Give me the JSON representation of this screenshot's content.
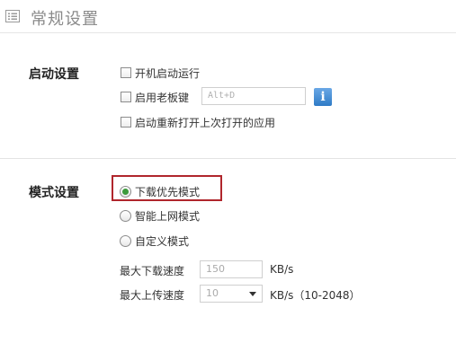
{
  "header": {
    "title": "常规设置",
    "icon": "list-settings-icon"
  },
  "startup": {
    "label": "启动设置",
    "options": [
      {
        "label": "开机启动运行",
        "checked": false
      },
      {
        "label": "启用老板键",
        "checked": false
      },
      {
        "label": "启动重新打开上次打开的应用",
        "checked": false
      }
    ],
    "hotkey": {
      "value": "Alt+D",
      "info_label": "i"
    }
  },
  "mode": {
    "label": "模式设置",
    "options": [
      {
        "label": "下载优先模式",
        "selected": true
      },
      {
        "label": "智能上网模式",
        "selected": false
      },
      {
        "label": "自定义模式",
        "selected": false
      }
    ],
    "highlight_color": "#b0262c"
  },
  "speed": {
    "download": {
      "label": "最大下载速度",
      "value": "150",
      "unit": "KB/s"
    },
    "upload": {
      "label": "最大上传速度",
      "value": "10",
      "unit": "KB/s（10-2048）"
    }
  }
}
